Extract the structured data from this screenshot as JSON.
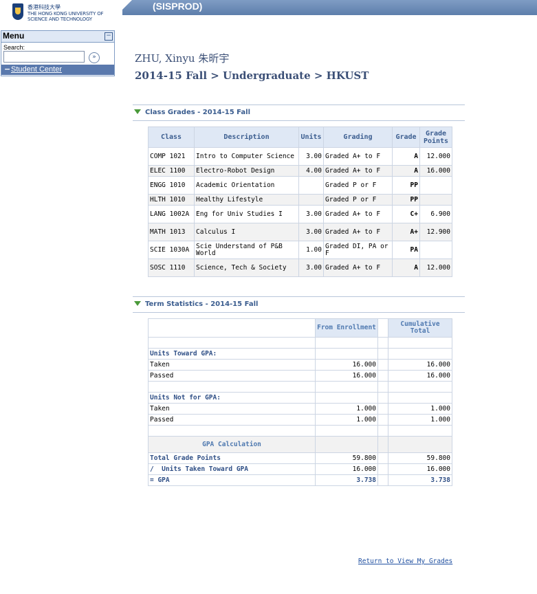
{
  "header": {
    "logo_line1": "香港科技大學",
    "logo_line2": "THE HONG KONG UNIVERSITY OF",
    "logo_line3": "SCIENCE AND TECHNOLOGY",
    "system_title": "(SISPROD)"
  },
  "menu": {
    "title": "Menu",
    "collapse": "−",
    "search_label": "Search:",
    "search_value": "",
    "go_icon": "»",
    "items": [
      {
        "label": "Student Center",
        "expander": "−"
      }
    ]
  },
  "student": {
    "name": "ZHU, Xinyu 朱昕宇",
    "term_path": "2014-15 Fall > Undergraduate > HKUST"
  },
  "class_grades": {
    "title": "Class Grades - 2014-15 Fall",
    "columns": [
      "Class",
      "Description",
      "Units",
      "Grading",
      "Grade",
      "Grade Points"
    ],
    "rows": [
      {
        "class": "COMP 1021",
        "description": "Intro to Computer Science",
        "units": "3.00",
        "grading": "Graded A+ to F",
        "grade": "A",
        "points": "12.000"
      },
      {
        "class": "ELEC 1100",
        "description": "Electro-Robot Design",
        "units": "4.00",
        "grading": "Graded A+ to F",
        "grade": "A",
        "points": "16.000"
      },
      {
        "class": "ENGG 1010",
        "description": "Academic Orientation",
        "units": "",
        "grading": "Graded P or F",
        "grade": "PP",
        "points": ""
      },
      {
        "class": "HLTH 1010",
        "description": "Healthy Lifestyle",
        "units": "",
        "grading": "Graded P or F",
        "grade": "PP",
        "points": ""
      },
      {
        "class": "LANG 1002A",
        "description": "Eng for Univ Studies I",
        "units": "3.00",
        "grading": "Graded A+ to F",
        "grade": "C+",
        "points": "6.900"
      },
      {
        "class": "MATH 1013",
        "description": "Calculus I",
        "units": "3.00",
        "grading": "Graded A+ to F",
        "grade": "A+",
        "points": "12.900"
      },
      {
        "class": "SCIE 1030A",
        "description": "Scie Understand of P&B World",
        "units": "1.00",
        "grading": "Graded DI, PA or F",
        "grade": "PA",
        "points": ""
      },
      {
        "class": "SOSC 1110",
        "description": "Science, Tech & Society",
        "units": "3.00",
        "grading": "Graded A+ to F",
        "grade": "A",
        "points": "12.000"
      }
    ]
  },
  "term_stats": {
    "title": "Term Statistics - 2014-15 Fall",
    "col_enrollment": "From Enrollment",
    "col_cumulative": "Cumulative Total",
    "units_toward_gpa": "Units Toward GPA:",
    "units_not_for_gpa": "Units Not for GPA:",
    "taken": "Taken",
    "passed": "Passed",
    "toward": {
      "taken": [
        "16.000",
        "16.000"
      ],
      "passed": [
        "16.000",
        "16.000"
      ]
    },
    "not_for": {
      "taken": [
        "1.000",
        "1.000"
      ],
      "passed": [
        "1.000",
        "1.000"
      ]
    },
    "gpa_calc": "GPA Calculation",
    "total_grade_points": "Total Grade Points",
    "tgp": [
      "59.800",
      "59.800"
    ],
    "units_taken_toward_gpa": "/  Units Taken Toward GPA",
    "utg": [
      "16.000",
      "16.000"
    ],
    "gpa_label": "= GPA",
    "gpa": [
      "3.738",
      "3.738"
    ]
  },
  "return_link": "Return to View My Grades"
}
